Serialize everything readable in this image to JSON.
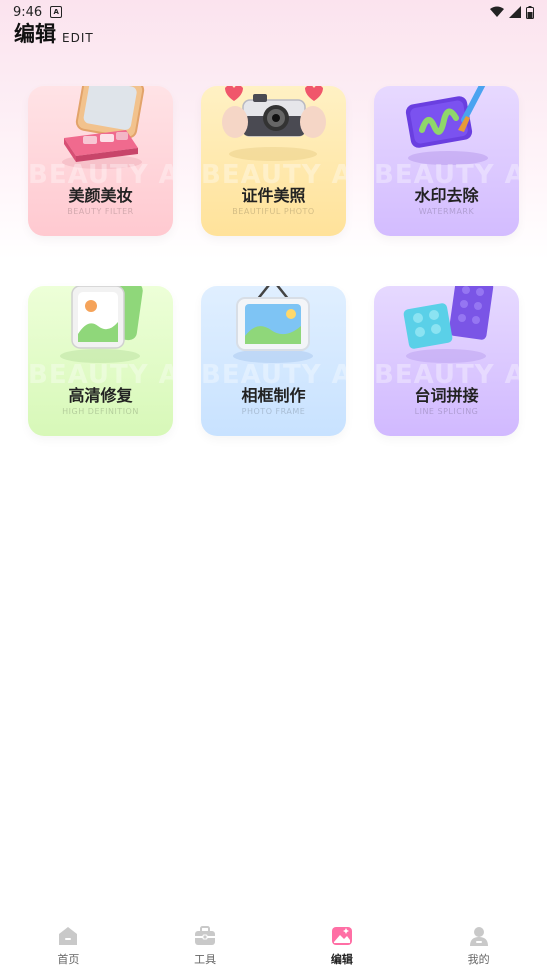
{
  "status_bar": {
    "time": "9:46",
    "notification_icon": "a-icon",
    "icons": [
      "wifi-icon",
      "signal-icon",
      "battery-icon"
    ]
  },
  "header": {
    "title": "编辑",
    "subtitle": "EDIT"
  },
  "cards": [
    {
      "id": "beauty",
      "title": "美颜美妆",
      "sub": "BEAUTY FILTER",
      "watermark": "BEAUTY AN",
      "icon": "makeup-compact-icon"
    },
    {
      "id": "id-photo",
      "title": "证件美照",
      "sub": "BEAUTIFUL PHOTO",
      "watermark": "BEAUTY AN",
      "icon": "camera-hands-icon"
    },
    {
      "id": "watermark",
      "title": "水印去除",
      "sub": "WATERMARK",
      "watermark": "BEAUTY AN",
      "icon": "paint-brush-icon"
    },
    {
      "id": "hd",
      "title": "高清修复",
      "sub": "HIGH DEFINITION",
      "watermark": "BEAUTY AN",
      "icon": "image-stack-icon"
    },
    {
      "id": "frame",
      "title": "相框制作",
      "sub": "PHOTO FRAME",
      "watermark": "BEAUTY AN",
      "icon": "hanging-frame-icon"
    },
    {
      "id": "splice",
      "title": "台词拼接",
      "sub": "LINE SPLICING",
      "watermark": "BEAUTY AN",
      "icon": "building-blocks-icon"
    }
  ],
  "tabs": [
    {
      "label": "首页",
      "icon": "home-icon",
      "active": false
    },
    {
      "label": "工具",
      "icon": "toolbox-icon",
      "active": false
    },
    {
      "label": "编辑",
      "icon": "edit-image-icon",
      "active": true
    },
    {
      "label": "我的",
      "icon": "user-icon",
      "active": false
    }
  ],
  "colors": {
    "accent": "#ff6fa5",
    "tab_inactive": "#c9c9c9"
  }
}
